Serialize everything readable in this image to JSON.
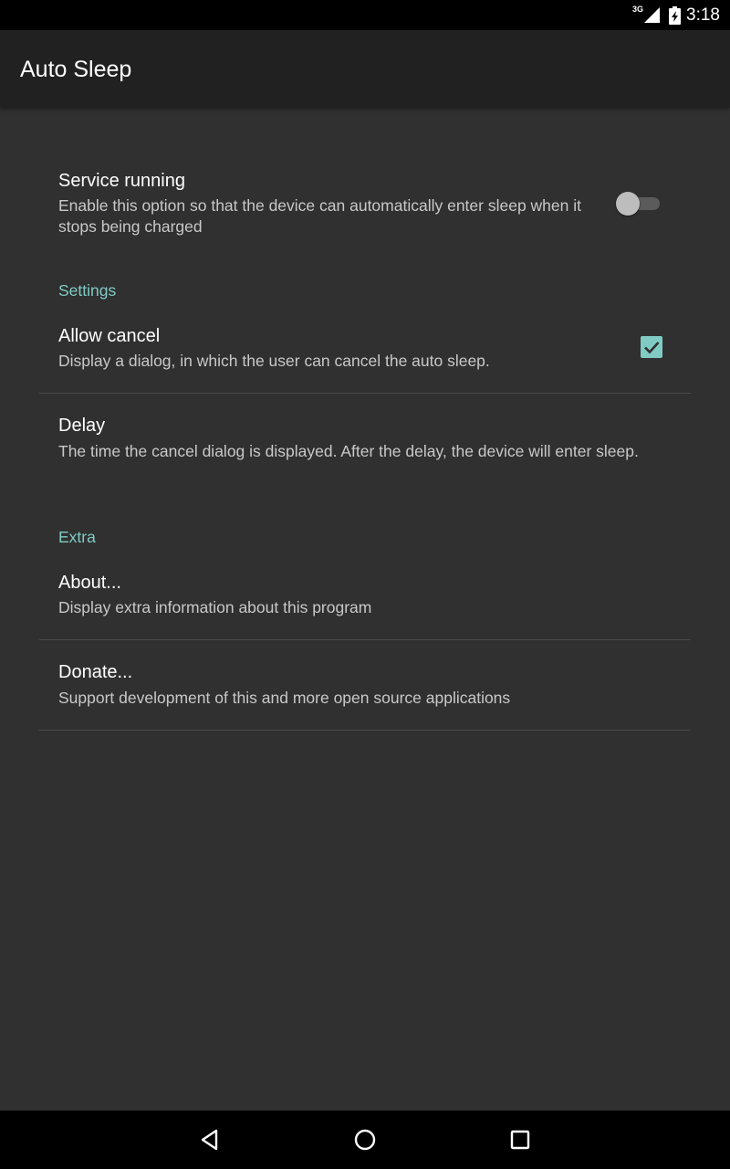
{
  "status_bar": {
    "network_type": "3G",
    "time": "3:18",
    "icons": [
      "signal-icon",
      "battery-charging-icon"
    ]
  },
  "app_bar": {
    "title": "Auto Sleep"
  },
  "preferences": {
    "service_running": {
      "title": "Service running",
      "summary": "Enable this option so that the device can automatically enter sleep when it stops being charged",
      "enabled": false
    },
    "settings_category": "Settings",
    "allow_cancel": {
      "title": "Allow cancel",
      "summary": "Display a dialog, in which the user can cancel the auto sleep.",
      "checked": true
    },
    "delay": {
      "title": "Delay",
      "summary": "The time the cancel dialog is displayed. After the delay, the device will enter sleep."
    },
    "extra_category": "Extra",
    "about": {
      "title": "About...",
      "summary": "Display extra information about this program"
    },
    "donate": {
      "title": "Donate...",
      "summary": "Support development of this and more open source applications"
    }
  },
  "nav_bar": {
    "icons": [
      "back-icon",
      "home-icon",
      "recents-icon"
    ]
  },
  "colors": {
    "background": "#303030",
    "app_bar": "#212121",
    "accent": "#80cbc4",
    "switch_off_thumb": "#bdbdbd"
  }
}
